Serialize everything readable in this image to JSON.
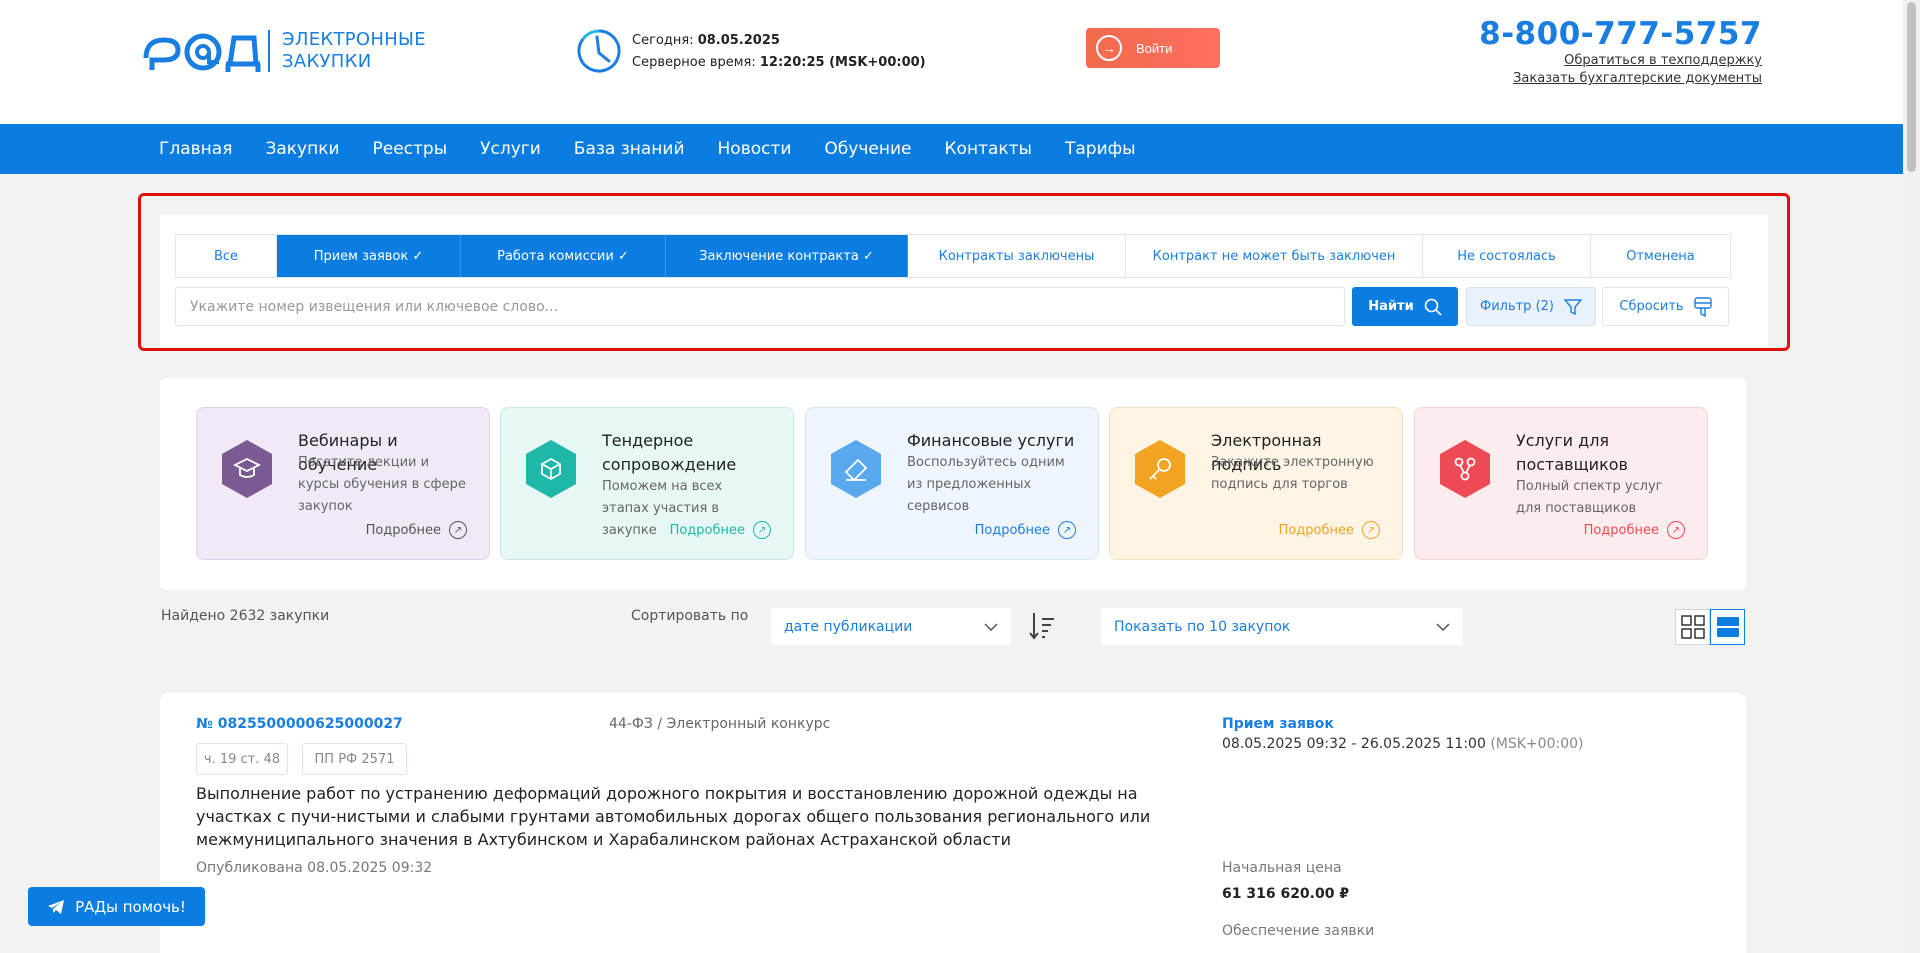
{
  "header": {
    "logo_text_line1": "ЭЛЕКТРОННЫЕ",
    "logo_text_line2": "ЗАКУПКИ",
    "today_label": "Сегодня:",
    "today_value": "08.05.2025",
    "server_time_label": "Серверное время:",
    "server_time_value": "12:20:25 (MSK+00:00)",
    "login_label": "Войти",
    "phone": "8-800-777-5757",
    "support_link": "Обратиться в техподдержку",
    "docs_link": "Заказать бухгалтерские документы"
  },
  "nav": [
    "Главная",
    "Закупки",
    "Реестры",
    "Услуги",
    "База знаний",
    "Новости",
    "Обучение",
    "Контакты",
    "Тарифы"
  ],
  "filter": {
    "tabs": [
      {
        "label": "Все",
        "active": false
      },
      {
        "label": "Прием заявок ✓",
        "active": true
      },
      {
        "label": "Работа комиссии ✓",
        "active": true
      },
      {
        "label": "Заключение контракта ✓",
        "active": true
      },
      {
        "label": "Контракты заключены",
        "active": false
      },
      {
        "label": "Контракт не может быть заключен",
        "active": false
      },
      {
        "label": "Не состоялась",
        "active": false
      },
      {
        "label": "Отменена",
        "active": false
      }
    ],
    "search_placeholder": "Укажите номер извещения или ключевое слово...",
    "search_value": "",
    "find_label": "Найти",
    "filter_label": "Фильтр (2)",
    "reset_label": "Сбросить"
  },
  "services": [
    {
      "title": "Вебинары и обучение",
      "desc": "Посетите лекции и курсы обучения в сфере закупок",
      "more": "Подробнее",
      "icon": "graduation-cap-icon",
      "color": "#7b5a94",
      "bg": "#f1eaf6",
      "border": "#e0d2ea",
      "link_color": "#555"
    },
    {
      "title": "Тендерное сопровождение",
      "desc": "Поможем на всех этапах участия в закупке",
      "more": "Подробнее",
      "icon": "cube-icon",
      "color": "#1fb8a8",
      "bg": "#e6f7f5",
      "border": "#c7ece7",
      "link_color": "#1fb8a8"
    },
    {
      "title": "Финансовые услуги",
      "desc": "Воспользуйтесь одним из предложенных сервисов",
      "more": "Подробнее",
      "icon": "card-icon",
      "color": "#5aa8ee",
      "bg": "#eef5fd",
      "border": "#d6e6f8",
      "link_color": "#1a7ee0"
    },
    {
      "title": "Электронная подпись",
      "desc": "Закажите электронную подпись для торгов",
      "more": "Подробнее",
      "icon": "key-icon",
      "color": "#f2a322",
      "bg": "#fdf4e6",
      "border": "#f6e2c0",
      "link_color": "#f2a322"
    },
    {
      "title": "Услуги для поставщиков",
      "desc": "Полный спектр услуг для поставщиков",
      "more": "Подробнее",
      "icon": "share-icon",
      "color": "#ee4a55",
      "bg": "#fdeced",
      "border": "#f7d3d6",
      "link_color": "#ee4a55"
    }
  ],
  "results": {
    "found": "Найдено 2632 закупки",
    "sort_label": "Сортировать по",
    "sort_value": "дате публикации",
    "per_page": "Показать по 10 закупок"
  },
  "item": {
    "number": "№ 0825500000625000027",
    "law": "44-ФЗ / Электронный конкурс",
    "chip1": "ч. 19 ст. 48",
    "chip2": "ПП РФ 2571",
    "title": "Выполнение работ по устранению деформаций дорожного покрытия и восстановлению дорожной одежды на участках с пучи-нистыми и слабыми грунтами автомобильных дорогах общего пользования регионального или межмуниципального значения в Ахтубинском и Харабалинском районах Астраханской области",
    "published": "Опубликована 08.05.2025 09:32",
    "status": "Прием заявок",
    "dates": "08.05.2025 09:32 - 26.05.2025 11:00",
    "tz": "(MSK+00:00)",
    "price_label": "Начальная цена",
    "price": "61 316 620.00 ₽",
    "security_label": "Обеспечение заявки"
  },
  "help_label": "РАДы помочь!",
  "colors": {
    "accent": "#0b7de0",
    "login": "#f26a4b",
    "highlight": "#e01010"
  }
}
